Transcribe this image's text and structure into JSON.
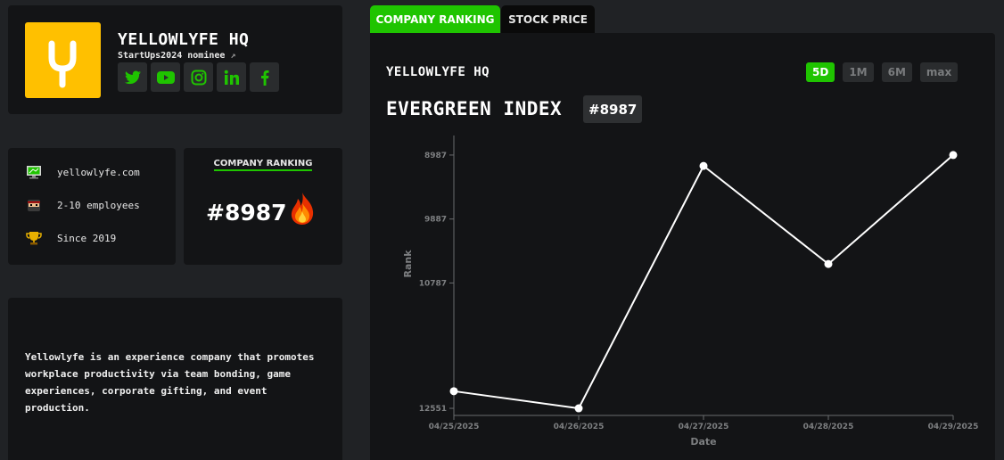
{
  "profile": {
    "company_name": "YELLOWLYFE HQ",
    "nominee": "StartUps2024 nominee",
    "socials": [
      "twitter-icon",
      "youtube-icon",
      "instagram-icon",
      "linkedin-icon",
      "facebook-icon"
    ],
    "accent": "#1fc400",
    "logo_color": "#ffc000"
  },
  "info": {
    "website": "yellowlyfe.com",
    "employees": "2-10 employees",
    "since": "Since 2019"
  },
  "ranking_card": {
    "title": "COMPANY RANKING",
    "value": "#8987"
  },
  "description": "Yellowlyfe is an experience company that promotes workplace productivity via team bonding, game experiences, corporate gifting, and event production.",
  "tabs": [
    {
      "label": "COMPANY RANKING",
      "active": true
    },
    {
      "label": "STOCK PRICE",
      "active": false
    }
  ],
  "panel": {
    "company": "YELLOWLYFE HQ",
    "index_title": "EVERGREEN INDEX",
    "badge": "#8987",
    "ranges": [
      "5D",
      "1M",
      "6M",
      "max"
    ],
    "active_range": "5D"
  },
  "chart_data": {
    "type": "line",
    "x": [
      "04/25/2025",
      "04/26/2025",
      "04/27/2025",
      "04/28/2025",
      "04/29/2025"
    ],
    "series": [
      {
        "values": [
          12310,
          12551,
          9140,
          10520,
          8987
        ]
      }
    ],
    "xlabel": "Date",
    "ylabel": "Rank",
    "yticks": [
      8987,
      9887,
      10787,
      12551
    ],
    "ylim": [
      12651,
      8737
    ],
    "inverted_y": true,
    "grid": false
  }
}
